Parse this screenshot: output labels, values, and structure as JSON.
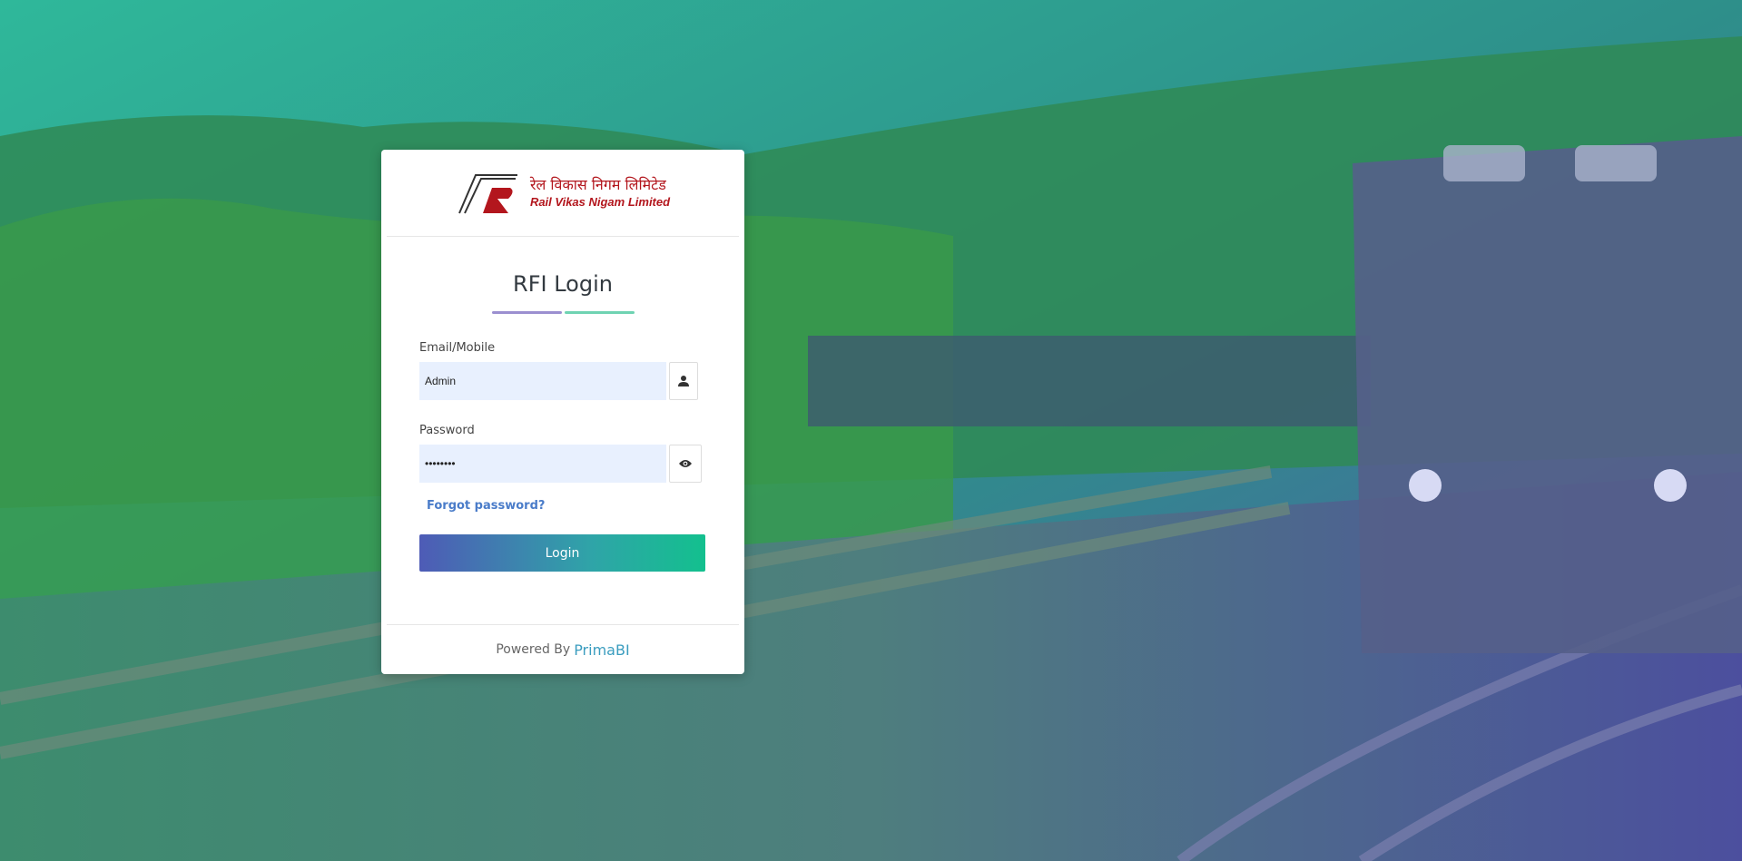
{
  "brand": {
    "hindi_name": "रेल विकास निगम लिमिटेड",
    "english_name": "Rail Vikas Nigam Limited",
    "color": "#b3161d"
  },
  "login": {
    "title": "RFI Login",
    "email_label": "Email/Mobile",
    "email_value": "Admin",
    "password_label": "Password",
    "password_value": "••••••••",
    "forgot_link": "Forgot password?",
    "submit_label": "Login"
  },
  "footer": {
    "powered_by": "Powered By",
    "vendor": "PrimaBI"
  },
  "icons": {
    "user": "user-icon",
    "eye": "eye-icon"
  },
  "colors": {
    "accent_start": "#4e5bb6",
    "accent_end": "#13c08e",
    "link": "#4a7cc9"
  }
}
